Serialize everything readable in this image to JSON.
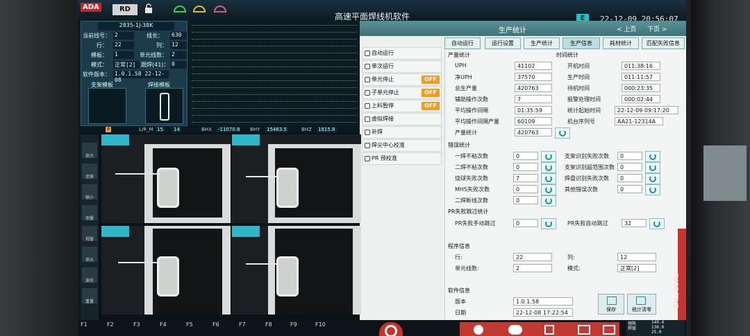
{
  "header": {
    "logo": "ADA",
    "mode": "RD",
    "title": "高速平面焊线机软件",
    "status_badge": "E",
    "date": "22-12-09",
    "time": "20:56:07"
  },
  "info_panel": {
    "product": "2835-1J-38K",
    "rows": [
      {
        "label": "当前线号：",
        "value": "2",
        "label2": "线长：",
        "value2": "630"
      },
      {
        "label": "行：",
        "value": "22",
        "label2": "列：",
        "value2": "12"
      },
      {
        "label": "模板：",
        "value": "1",
        "label2": "单元线数：",
        "value2": "2"
      },
      {
        "label": "模式：",
        "value": "正常[2]",
        "label2": "跟焊(41)：",
        "value2": "0"
      },
      {
        "label": "软件版本：",
        "value": "1.0.1.58 22-12-08",
        "label2": "",
        "value2": ""
      }
    ],
    "support_template": "支架模板",
    "bond_template": "焊接模板"
  },
  "app": {
    "section_title": "生产统计",
    "prev_page": "< 上页",
    "next_page": "下页 >",
    "tabs": [
      "自动运行",
      "运行设置",
      "生产统计",
      "生产信息",
      "耗材统计",
      "匹配失败信息"
    ],
    "active_tab": "生产信息",
    "menu": [
      {
        "label": "自动运行",
        "toggle": ""
      },
      {
        "label": "单次运行",
        "toggle": ""
      },
      {
        "label": "单元停止",
        "toggle": "OFF"
      },
      {
        "label": "子单元停止",
        "toggle": "OFF"
      },
      {
        "label": "上料暂停",
        "toggle": "OFF"
      },
      {
        "label": "虚拟焊接",
        "toggle": ""
      },
      {
        "label": "补焊",
        "toggle": ""
      },
      {
        "label": "焊尖中心校准",
        "toggle": ""
      },
      {
        "label": "PR 预校准",
        "toggle": ""
      }
    ],
    "production": {
      "heading": "产量统计",
      "items": [
        {
          "label": "UPH",
          "value": "41102"
        },
        {
          "label": "净UPH",
          "value": "37570"
        },
        {
          "label": "总生产量",
          "value": "420763"
        },
        {
          "label": "辅助操作次数",
          "value": "7"
        },
        {
          "label": "平均操作间隔",
          "value": "01:35:59"
        },
        {
          "label": "平均操作间隔产量",
          "value": "60109"
        },
        {
          "label": "产量统计",
          "value": "420763"
        }
      ]
    },
    "time_stats": {
      "heading": "时间统计",
      "items": [
        {
          "label": "开机时间",
          "value": "011:38:16"
        },
        {
          "label": "生产时间",
          "value": "011:11:57"
        },
        {
          "label": "待机时间",
          "value": "000:23:35"
        },
        {
          "label": "报警处理时间",
          "value": "000:02:44"
        },
        {
          "label": "统计起始时间",
          "value": "22-12-09 09:17:20"
        },
        {
          "label": "机台序列号",
          "value": "AA21-12314A"
        }
      ]
    },
    "errors": {
      "heading": "错误统计",
      "left": [
        {
          "label": "一焊不粘次数",
          "value": "0"
        },
        {
          "label": "二焊不粘次数",
          "value": "0"
        },
        {
          "label": "烧球失败次数",
          "value": "7"
        },
        {
          "label": "MHS失败次数",
          "value": "0"
        },
        {
          "label": "二焊断线次数",
          "value": "0"
        }
      ],
      "right": [
        {
          "label": "支架识别失败次数",
          "value": "0"
        },
        {
          "label": "支架识别超范围次数",
          "value": "0"
        },
        {
          "label": "焊盘识别失败次数",
          "value": "0"
        },
        {
          "label": "其他错误次数",
          "value": "0"
        }
      ]
    },
    "pr_skip": {
      "heading": "PR失败跳过统计",
      "manual_label": "PR失败手动跳过",
      "manual_value": "0",
      "auto_label": "PR失败自动跳过",
      "auto_value": "32"
    },
    "program": {
      "heading": "程序信息",
      "row_label": "行:",
      "row_value": "22",
      "col_label": "列:",
      "col_value": "12",
      "unit_lines_label": "单元线数:",
      "unit_lines_value": "2",
      "mode_label": "模式:",
      "mode_value": "正常[2]"
    },
    "software": {
      "heading": "软件信息",
      "version_label": "版本",
      "version_value": "1.0.1.58",
      "date_label": "日期",
      "date_value": "22-12-08 17:22:54"
    },
    "save_label": "保存",
    "clear_label": "统计清零",
    "side_label": "BALL BOND"
  },
  "camera": {
    "status": {
      "mode": "P",
      "lr_label": "L/R_M",
      "lr_values": [
        "15",
        "14"
      ],
      "bhx_label": "BHX",
      "bhx": "-11070.8",
      "bhy_label": "BHY",
      "bhy": "15463.5",
      "bhz_label": "BHZ",
      "bhz": "1815.8"
    },
    "tools": [
      "放大",
      "还原",
      "缩小",
      "测量",
      "视窗",
      "单元",
      "波形",
      "重量"
    ]
  },
  "bottom": {
    "fkeys": [
      "F1",
      "F2",
      "F3",
      "F4",
      "F5",
      "F6",
      "F7",
      "F8",
      "F9",
      "F10"
    ],
    "gauges": [
      {
        "label": "预热",
        "value": "149.4"
      },
      {
        "label": "焊接",
        "value": "130.0"
      },
      {
        "label": "",
        "value": "25.0"
      }
    ]
  }
}
